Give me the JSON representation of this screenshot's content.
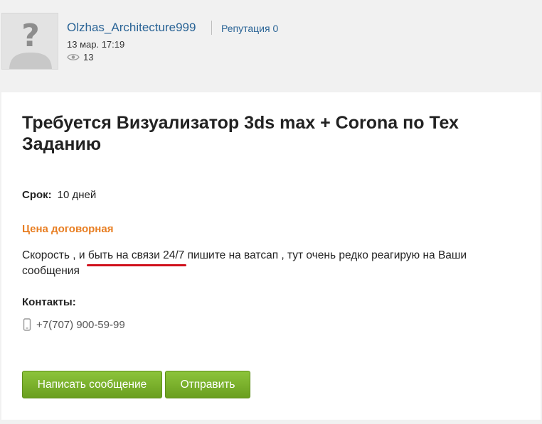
{
  "author": {
    "username": "Olzhas_Architecture999",
    "reputation": "Репутация 0",
    "date": "13 мар. 17:19",
    "views": "13"
  },
  "post": {
    "title": "Требуется Визуализатор 3ds max + Corona по Тех Заданию",
    "term_label": "Срок:",
    "term_value": "10 дней",
    "price": "Цена договорная",
    "desc_before": "Скорость , и ",
    "desc_highlight": "быть на связи 24/7",
    "desc_after": " пишите на ватсап , тут очень редко реагирую на Ваши сообщения",
    "highlight_color": "#d0101b",
    "contacts_label": "Контакты:",
    "phone": "+7(707) 900-59-99"
  },
  "actions": {
    "message_label": "Написать сообщение",
    "send_label": "Отправить",
    "accent_color": "#7cb32b"
  },
  "icons": [
    "avatar-placeholder-icon",
    "eye-icon",
    "phone-icon"
  ]
}
